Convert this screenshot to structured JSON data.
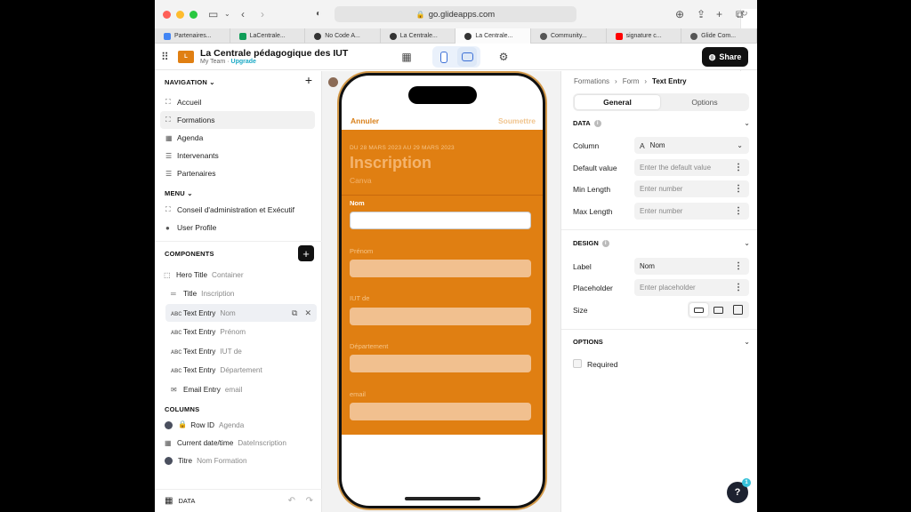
{
  "browser": {
    "url": "go.glideapps.com",
    "tabs": [
      {
        "label": "Partenaires...",
        "color": "#4285f4"
      },
      {
        "label": "LaCentrale...",
        "color": "#0f9d58"
      },
      {
        "label": "No Code A...",
        "color": "#333333"
      },
      {
        "label": "La Centrale...",
        "color": "#333333"
      },
      {
        "label": "La Centrale...",
        "color": "#333333"
      },
      {
        "label": "Community...",
        "color": "#555555"
      },
      {
        "label": "signature c...",
        "color": "#ff0000"
      },
      {
        "label": "Glide Com...",
        "color": "#555555"
      }
    ]
  },
  "app": {
    "title": "La Centrale pédagogique des IUT",
    "team": "My Team",
    "separator": "·",
    "upgrade": "Upgrade",
    "logo_letter": "L",
    "share": "Share"
  },
  "sidebar": {
    "navigation_header": "NAVIGATION",
    "nav_items": [
      "Accueil",
      "Formations",
      "Agenda",
      "Intervenants",
      "Partenaires"
    ],
    "menu_header": "MENU",
    "menu_items": [
      "Conseil d'administration et Exécutif",
      "User Profile"
    ],
    "components_header": "COMPONENTS",
    "components": [
      {
        "name": "Hero Title",
        "sub": "Container"
      },
      {
        "name": "Title",
        "sub": "Inscription"
      },
      {
        "name": "Text Entry",
        "sub": "Nom"
      },
      {
        "name": "Text Entry",
        "sub": "Prénom"
      },
      {
        "name": "Text Entry",
        "sub": "IUT de"
      },
      {
        "name": "Text Entry",
        "sub": "Département"
      },
      {
        "name": "Email Entry",
        "sub": "email"
      }
    ],
    "columns_header": "COLUMNS",
    "columns": [
      {
        "name": "Row ID",
        "sub": "Agenda"
      },
      {
        "name": "Current date/time",
        "sub": "DateInscription"
      },
      {
        "name": "Titre",
        "sub": "Nom Formation"
      }
    ],
    "footer": "DATA"
  },
  "canvas": {
    "form": {
      "cancel": "Annuler",
      "submit": "Soumettre",
      "date": "DU 28 MARS 2023 AU 29 MARS 2023",
      "title": "Inscription",
      "subtitle": "Canva",
      "fields": [
        "Nom",
        "Prénom",
        "IUT de",
        "Département",
        "email"
      ]
    }
  },
  "panel": {
    "breadcrumb": [
      "Formations",
      "Form",
      "Text Entry"
    ],
    "tabs": [
      "General",
      "Options"
    ],
    "data_header": "DATA",
    "column_label": "Column",
    "column_value": "Nom",
    "column_type": "A",
    "default_label": "Default value",
    "default_placeholder": "Enter the default value",
    "min_label": "Min Length",
    "min_placeholder": "Enter number",
    "max_label": "Max Length",
    "max_placeholder": "Enter number",
    "design_header": "DESIGN",
    "label_label": "Label",
    "label_value": "Nom",
    "placeholder_label": "Placeholder",
    "placeholder_placeholder": "Enter placeholder",
    "size_label": "Size",
    "options_header": "OPTIONS",
    "required_label": "Required",
    "help_badge": "1",
    "help": "?"
  },
  "colors": {
    "accent": "#e07f12",
    "brand_dark": "#111111",
    "upgrade": "#1aa9c5"
  }
}
